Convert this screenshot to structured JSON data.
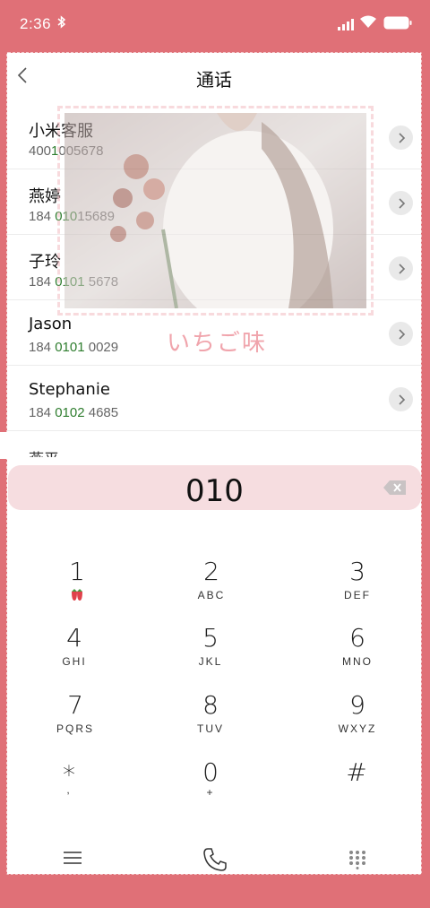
{
  "status_bar": {
    "time": "2:36"
  },
  "header": {
    "title": "通话"
  },
  "contacts": [
    {
      "name": "小米客服",
      "number_pre": "400",
      "number_hl": "1",
      "number_post": "005678"
    },
    {
      "name": "燕婷",
      "number_pre": "184 ",
      "number_hl": "010",
      "number_post": "15689"
    },
    {
      "name": "子玲",
      "number_pre": "184 ",
      "number_hl": "0101",
      "number_post": " 5678"
    },
    {
      "name": "Jason",
      "number_pre": "184 ",
      "number_hl": "0101",
      "number_post": " 0029"
    },
    {
      "name": "Stephanie",
      "number_pre": "184 ",
      "number_hl": "0102",
      "number_post": " 4685"
    }
  ],
  "partial_contact": "燕平",
  "overlay": {
    "brand_text": "いちご味"
  },
  "dialer": {
    "value": "010"
  },
  "keypad": {
    "keys": [
      {
        "digit": "1",
        "letters": ""
      },
      {
        "digit": "2",
        "letters": "ABC"
      },
      {
        "digit": "3",
        "letters": "DEF"
      },
      {
        "digit": "4",
        "letters": "GHI"
      },
      {
        "digit": "5",
        "letters": "JKL"
      },
      {
        "digit": "6",
        "letters": "MNO"
      },
      {
        "digit": "7",
        "letters": "PQRS"
      },
      {
        "digit": "8",
        "letters": "TUV"
      },
      {
        "digit": "9",
        "letters": "WXYZ"
      },
      {
        "digit": "*",
        "letters": ","
      },
      {
        "digit": "0",
        "letters": "+"
      },
      {
        "digit": "#",
        "letters": ""
      }
    ]
  },
  "colors": {
    "background": "#e07077",
    "highlight": "#2e7d2e",
    "display": "#f6dde0"
  },
  "icons": [
    "bluetooth-icon",
    "signal-icon",
    "wifi-icon",
    "battery-icon",
    "back-icon",
    "chevron-right-icon",
    "backspace-icon",
    "strawberry-icon",
    "menu-icon",
    "phone-icon",
    "keypad-icon"
  ]
}
